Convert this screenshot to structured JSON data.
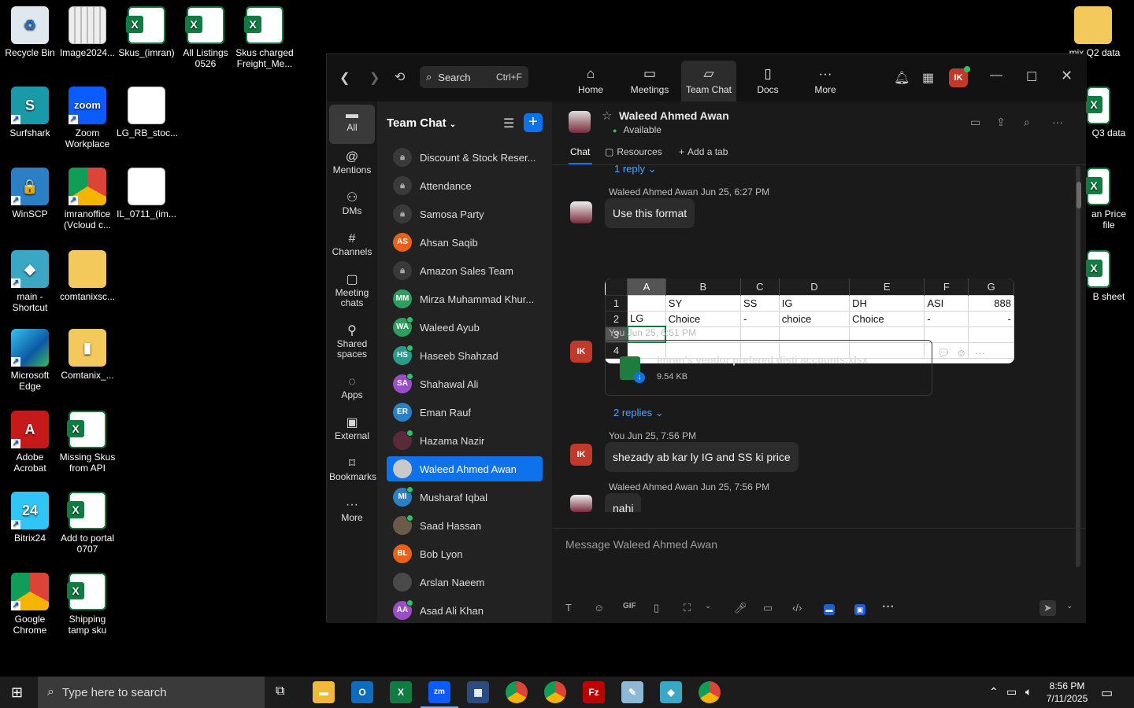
{
  "desktop": {
    "icons": [
      {
        "label": "Recycle Bin",
        "icon": "recycle-bin-icon"
      },
      {
        "label": "Image2024...",
        "icon": "image-file-icon"
      },
      {
        "label": "Skus_(imran)",
        "icon": "excel-file-icon"
      },
      {
        "label": "All Listings 0526",
        "icon": "excel-file-icon"
      },
      {
        "label": "Skus charged Freight_Me...",
        "icon": "excel-file-icon"
      },
      {
        "label": "Surfshark",
        "icon": "surfshark-icon"
      },
      {
        "label": "Zoom Workplace",
        "icon": "zoom-icon",
        "text": "zoom"
      },
      {
        "label": "LG_RB_stoc...",
        "icon": "text-file-icon"
      },
      {
        "label": "WinSCP",
        "icon": "winscp-icon"
      },
      {
        "label": "imranoffice (Vcloud c...",
        "icon": "chrome-icon"
      },
      {
        "label": "IL_0711_(im...",
        "icon": "text-file-icon"
      },
      {
        "label": "main - Shortcut",
        "icon": "app-shortcut-icon"
      },
      {
        "label": "comtanixsc...",
        "icon": "folder-icon"
      },
      {
        "label": "Microsoft Edge",
        "icon": "edge-icon"
      },
      {
        "label": "Comtanix_...",
        "icon": "zip-folder-icon"
      },
      {
        "label": "Adobe Acrobat",
        "icon": "acrobat-icon"
      },
      {
        "label": "Missing Skus from API",
        "icon": "excel-file-icon"
      },
      {
        "label": "Bitrix24",
        "icon": "bitrix-icon",
        "text": "24"
      },
      {
        "label": "Add to portal 0707",
        "icon": "excel-file-icon"
      },
      {
        "label": "Google Chrome",
        "icon": "chrome-icon"
      },
      {
        "label": "Shipping tamp sku",
        "icon": "excel-file-icon"
      },
      {
        "label": "mix Q2 data",
        "icon": "folder-icon"
      },
      {
        "label": "Q3 data",
        "icon": "excel-file-icon"
      },
      {
        "label": "an Price file",
        "icon": "excel-file-icon"
      },
      {
        "label": "B sheet",
        "icon": "excel-file-icon"
      }
    ]
  },
  "zoom": {
    "search": {
      "label": "Search",
      "shortcut": "Ctrl+F"
    },
    "nav_tabs": [
      {
        "label": "Home",
        "icon": "home-icon"
      },
      {
        "label": "Meetings",
        "icon": "video-camera-icon"
      },
      {
        "label": "Team Chat",
        "icon": "chat-bubbles-icon",
        "active": true
      },
      {
        "label": "Docs",
        "icon": "document-icon"
      },
      {
        "label": "More",
        "icon": "more-dots-icon"
      }
    ],
    "user_initials": "IK",
    "rail": [
      {
        "label": "All",
        "icon": "chat-icon",
        "active": true
      },
      {
        "label": "Mentions",
        "icon": "at-icon"
      },
      {
        "label": "DMs",
        "icon": "people-icon"
      },
      {
        "label": "Channels",
        "icon": "hash-icon"
      },
      {
        "label": "Meeting chats",
        "icon": "calendar-icon"
      },
      {
        "label": "Shared spaces",
        "icon": "shared-icon"
      },
      {
        "label": "Apps",
        "icon": "apps-icon"
      },
      {
        "label": "External",
        "icon": "external-icon"
      },
      {
        "label": "Bookmarks",
        "icon": "bookmark-icon"
      },
      {
        "label": "More",
        "icon": "more-dots-icon"
      }
    ],
    "list_title": "Team Chat",
    "chats": [
      {
        "name": "Discount & Stock Reser...",
        "type": "lock"
      },
      {
        "name": "Attendance",
        "type": "lock"
      },
      {
        "name": "Samosa Party",
        "type": "lock"
      },
      {
        "name": "Ahsan Saqib",
        "initials": "AS",
        "color": "#e8611a",
        "online": false
      },
      {
        "name": "Amazon Sales Team",
        "type": "lock"
      },
      {
        "name": "Mirza Muhammad Khur...",
        "initials": "MM",
        "color": "#2e9e5e",
        "online": false
      },
      {
        "name": "Waleed Ayub",
        "initials": "WA",
        "color": "#2e9e5e",
        "online": true
      },
      {
        "name": "Haseeb Shahzad",
        "initials": "HS",
        "color": "#2a9a8a",
        "online": true
      },
      {
        "name": "Shahawal Ali",
        "initials": "SA",
        "color": "#9b4dca",
        "online": true
      },
      {
        "name": "Eman Rauf",
        "initials": "ER",
        "color": "#2b7fc4",
        "online": false
      },
      {
        "name": "Hazama Nazir",
        "initials": "",
        "color": "#5a2a3a",
        "online": true
      },
      {
        "name": "Waleed Ahmed Awan",
        "initials": "",
        "color": "#c9c9c9",
        "online": false,
        "selected": true
      },
      {
        "name": "Musharaf Iqbal",
        "initials": "MI",
        "color": "#2b7fc4",
        "online": true
      },
      {
        "name": "Saad Hassan",
        "initials": "",
        "color": "#6b5a4a",
        "online": true
      },
      {
        "name": "Bob Lyon",
        "initials": "BL",
        "color": "#e8611a",
        "online": false
      },
      {
        "name": "Arslan Naeem",
        "initials": "",
        "color": "#4a4a4a",
        "online": false
      },
      {
        "name": "Asad Ali Khan",
        "initials": "AA",
        "color": "#9b4dca",
        "online": true
      }
    ],
    "chat": {
      "name": "Waleed Ahmed Awan",
      "status": "Available",
      "tabs": [
        "Chat",
        "Resources",
        "Add a tab"
      ],
      "messages": {
        "reply1": "1 reply",
        "m1_meta": "Waleed Ahmed Awan Jun 25, 6:27 PM",
        "m1_text": "Use this format",
        "sheet": {
          "cols": [
            "A",
            "B",
            "C",
            "D",
            "E",
            "F",
            "G"
          ],
          "rows": [
            [
              "1",
              "",
              "SY",
              "SS",
              "IG",
              "DH",
              "ASI",
              "888"
            ],
            [
              "2",
              "LG",
              "Choice",
              "-",
              "choice",
              "Choice",
              "-",
              "-"
            ],
            [
              "3",
              "",
              "",
              "",
              "",
              "",
              "",
              ""
            ],
            [
              "4",
              "",
              "",
              "",
              "",
              "",
              "",
              ""
            ]
          ]
        },
        "m2_meta": "You Jun 25, 6:51 PM",
        "file_name": "Imran's vendor prefered disti accounts.xlsx",
        "file_size": "9.54 KB",
        "reply2": "2 replies",
        "m3_meta": "You Jun 25, 7:56 PM",
        "m3_text": "shezady ab kar ly IG and SS ki price",
        "m4_meta": "Waleed Ahmed Awan Jun 25, 7:56 PM",
        "m4_text": "nahi"
      },
      "composer_placeholder": "Message Waleed Ahmed Awan"
    }
  },
  "taskbar": {
    "search_placeholder": "Type here to search",
    "time": "8:56 PM",
    "date": "7/11/2025",
    "apps": [
      "file-explorer-icon",
      "outlook-icon",
      "excel-icon",
      "zoom-icon",
      "calculator-icon",
      "chrome-icon",
      "chrome-icon",
      "filezilla-icon",
      "notepad-icon",
      "app-icon",
      "chrome-icon"
    ]
  }
}
